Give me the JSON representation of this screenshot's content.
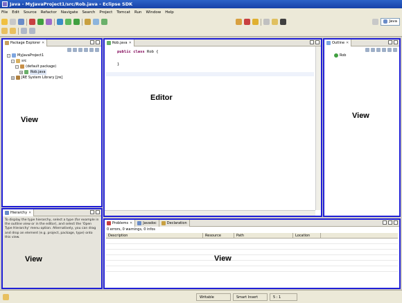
{
  "window": {
    "title": "Java - MyJavaProject1/src/Rob.java - Eclipse SDK"
  },
  "menu": [
    "File",
    "Edit",
    "Source",
    "Refactor",
    "Navigate",
    "Search",
    "Project",
    "Tomcat",
    "Run",
    "Window",
    "Help"
  ],
  "perspective": {
    "label": "Java"
  },
  "package_explorer": {
    "tab_label": "Package Explorer",
    "tree": [
      "MyJavaProject1",
      "src",
      "(default package)",
      "Rob.java",
      "JRE System Library [jre]"
    ],
    "view_label": "View"
  },
  "editor": {
    "tab_label": "Rob.java",
    "code": {
      "keyword1": "public",
      "keyword2": "class",
      "rest": " Rob {",
      "close": "}"
    },
    "label": "Editor"
  },
  "outline": {
    "tab_label": "Outline",
    "item": "Rob",
    "view_label": "View"
  },
  "hierarchy": {
    "tab_label": "Hierarchy",
    "message": "To display the type hierarchy, select a type (for example in the outline view or in the editor), and select the 'Open Type Hierarchy' menu option. Alternatively, you can drag and drop an element (e.g. project, package, type) onto this view.",
    "view_label": "View"
  },
  "problems": {
    "tabs": [
      "Problems",
      "Javadoc",
      "Declaration"
    ],
    "status": "0 errors, 0 warnings, 0 infos",
    "columns": [
      "Description",
      "Resource",
      "Path",
      "Location"
    ],
    "view_label": "View"
  },
  "statusbar": {
    "writable": "Writable",
    "insert_mode": "Smart Insert",
    "position": "5 : 1"
  },
  "colors": {
    "view_border": "#1f1fd6",
    "title_bar": "#1742a8",
    "keyword": "#7f0055"
  }
}
